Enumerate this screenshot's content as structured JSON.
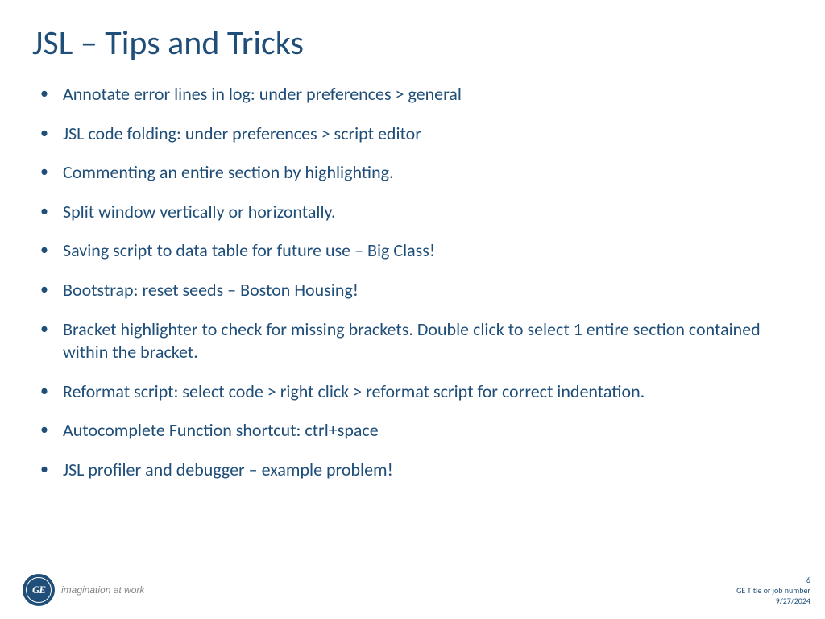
{
  "title": "JSL – Tips and Tricks",
  "bullets": [
    "Annotate error lines in log: under preferences > general",
    "JSL code folding: under preferences > script editor",
    "Commenting an entire section by highlighting.",
    "Split window vertically or horizontally.",
    "Saving script to data table for future use – Big Class!",
    "Bootstrap: reset seeds – Boston Housing!",
    "Bracket highlighter to check for missing brackets. Double click to select 1 entire section contained within the bracket.",
    "Reformat script: select code > right click  > reformat script for correct indentation.",
    "Autocomplete Function shortcut: ctrl+space",
    "JSL profiler and debugger – example problem!"
  ],
  "logo": {
    "monogram": "GE",
    "tagline": "imagination at work"
  },
  "footer": {
    "page": "6",
    "jobline": "GE Title or job number",
    "date": "9/27/2024"
  }
}
